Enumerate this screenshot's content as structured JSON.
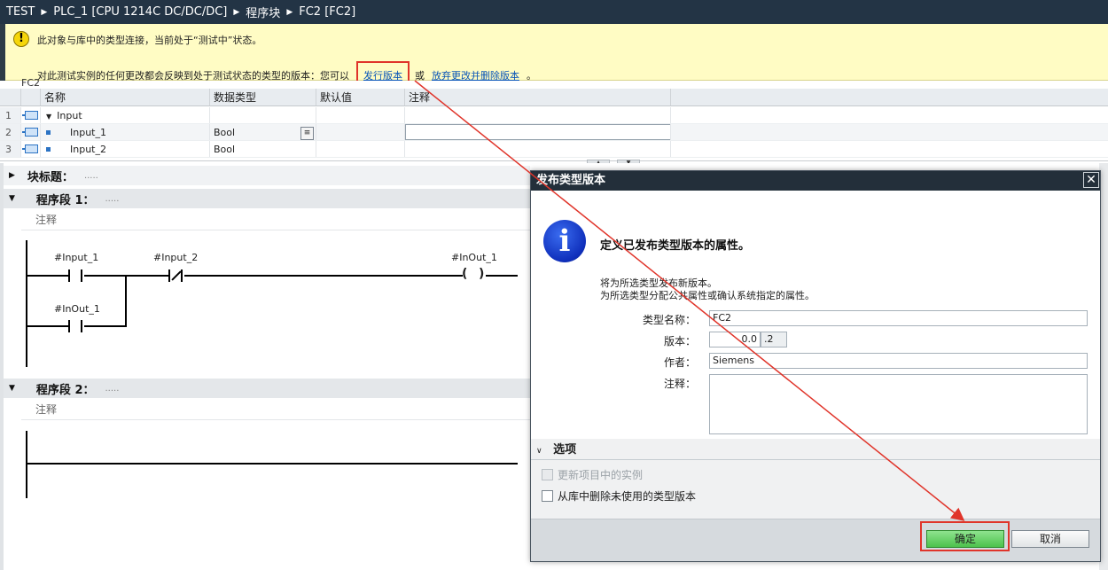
{
  "breadcrumb": {
    "items": [
      "TEST",
      "PLC_1 [CPU 1214C DC/DC/DC]",
      "程序块",
      "FC2 [FC2]"
    ]
  },
  "banner": {
    "line1": "此对象与库中的类型连接，当前处于“测试中”状态。",
    "line2_prefix": "对此测试实例的任何更改都会反映到处于测试状态的类型的版本：您可以",
    "release_link": "发行版本",
    "or_text": "或",
    "discard_link": "放弃更改并删除版本",
    "suffix": "。"
  },
  "interface": {
    "block_name": "FC2",
    "columns": [
      "名称",
      "数据类型",
      "默认值",
      "注释"
    ],
    "rows": [
      {
        "num": "1",
        "name": "Input",
        "type": "",
        "default": "",
        "comment": ""
      },
      {
        "num": "2",
        "name": "Input_1",
        "type": "Bool",
        "default": "",
        "comment": ""
      },
      {
        "num": "3",
        "name": "Input_2",
        "type": "Bool",
        "default": "",
        "comment": ""
      }
    ]
  },
  "editor": {
    "block_title_label": "块标题：",
    "block_title_value": ".....",
    "network1": {
      "title": "程序段 1：",
      "value": ".....",
      "comment": "注释"
    },
    "network2": {
      "title": "程序段 2：",
      "value": ".....",
      "comment": "注释"
    },
    "ladder": {
      "contact1": "#Input_1",
      "contact2": "#Input_2",
      "coil": "#InOut_1",
      "contact3": "#InOut_1"
    }
  },
  "dialog": {
    "title": "发布类型版本",
    "close": "✕",
    "heading": "定义已发布类型版本的属性。",
    "desc1": "将为所选类型发布新版本。",
    "desc2": "为所选类型分配公共属性或确认系统指定的属性。",
    "fields": {
      "type_name_label": "类型名称：",
      "type_name_value": "FC2",
      "version_label": "版本：",
      "version_major": "0.0",
      "version_minor": ".2",
      "author_label": "作者：",
      "author_value": "Siemens",
      "comment_label": "注释："
    },
    "options_title": "选项",
    "options": {
      "update_instances": "更新项目中的实例",
      "delete_unused": "从库中删除未使用的类型版本"
    },
    "ok_label": "确定",
    "cancel_label": "取消"
  },
  "colors": {
    "titlebar": "#233445",
    "banner": "#fffcc4",
    "highlight": "#e0342a",
    "ok_button": "#4cc24c"
  }
}
